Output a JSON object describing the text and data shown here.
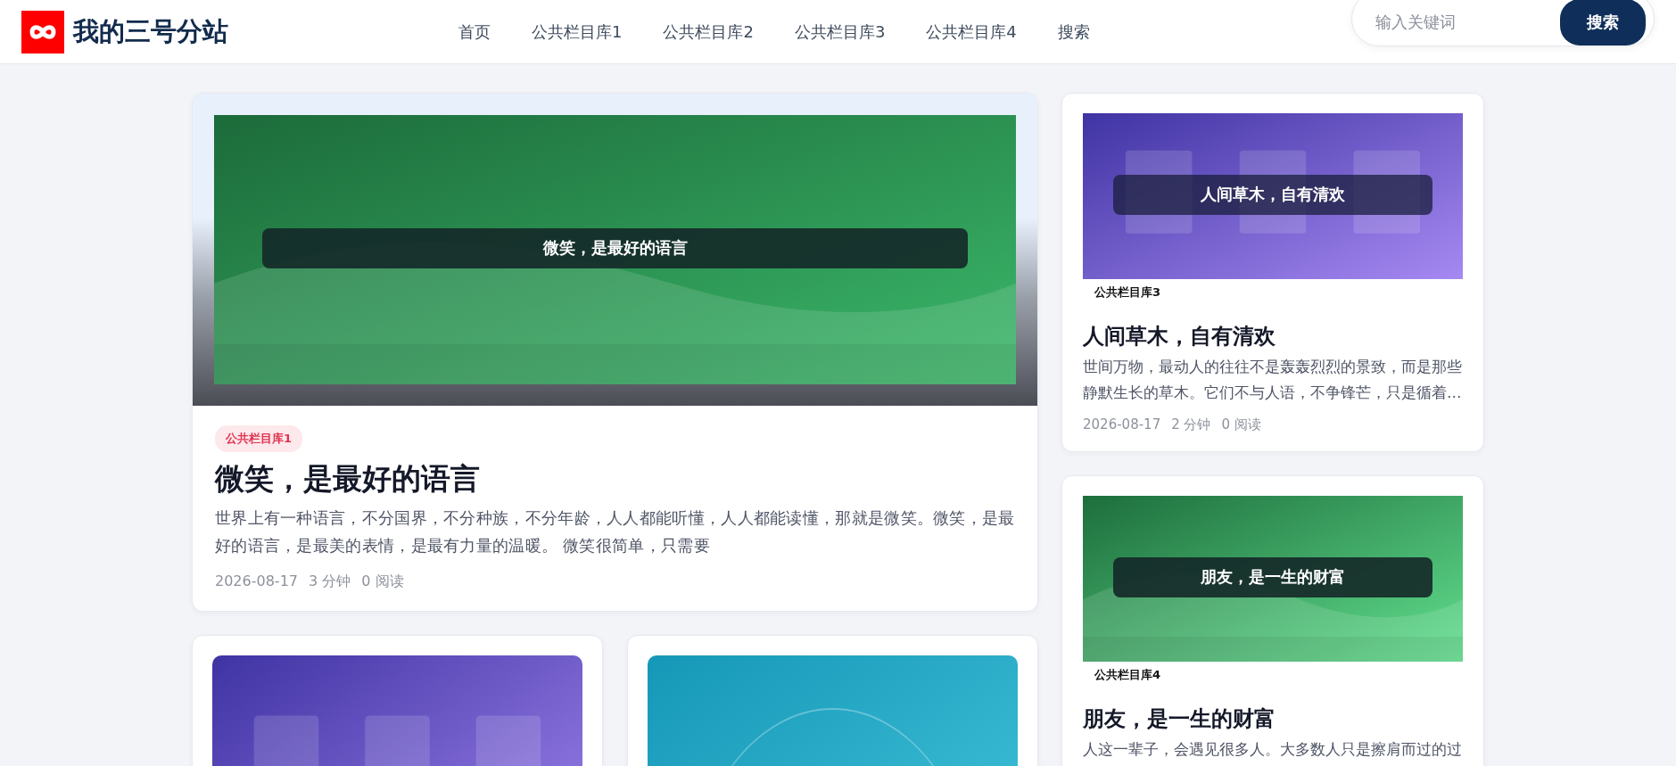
{
  "site": {
    "name": "我的三号分站"
  },
  "nav": [
    {
      "label": "首页"
    },
    {
      "label": "公共栏目库1"
    },
    {
      "label": "公共栏目库2"
    },
    {
      "label": "公共栏目库3"
    },
    {
      "label": "公共栏目库4"
    },
    {
      "label": "搜索"
    }
  ],
  "search": {
    "placeholder": "输入关键词",
    "button": "搜索"
  },
  "featured": {
    "cover": {
      "kind": "picture",
      "caption": "微笑，是最好的语言"
    },
    "tag": {
      "kind": "pill",
      "label": "公共栏目库1"
    },
    "title": "微笑，是最好的语言",
    "excerpt": "世界上有一种语言，不分国界，不分种族，不分年龄，人人都能听懂，人人都能读懂，那就是微笑。微笑，是最好的语言，是最美的表情，是最有力量的温暖。 微笑很简单，只需要",
    "date": "2026-08-17",
    "read_time": "3 分钟",
    "views": "0 阅读"
  },
  "side_posts": [
    {
      "cover": {
        "kind": "picture",
        "caption": "人间草木，自有清欢"
      },
      "tag": {
        "kind": "plain",
        "label": "公共栏目库3"
      },
      "title": "人间草木，自有清欢",
      "excerpt": "世间万物，最动人的往往不是轰轰烈烈的景致，而是那些静默生长的草木。它们不与人语，不争锋芒，只是循着…",
      "date": "2026-08-17",
      "read_time": "2 分钟",
      "views": "0 阅读"
    },
    {
      "cover": {
        "kind": "picture",
        "caption": "朋友，是一生的财富"
      },
      "tag": {
        "kind": "plain",
        "label": "公共栏目库4"
      },
      "title": "朋友，是一生的财富",
      "excerpt": "人这一辈子，会遇见很多人。大多数人只是擦肩而过的过"
    }
  ]
}
